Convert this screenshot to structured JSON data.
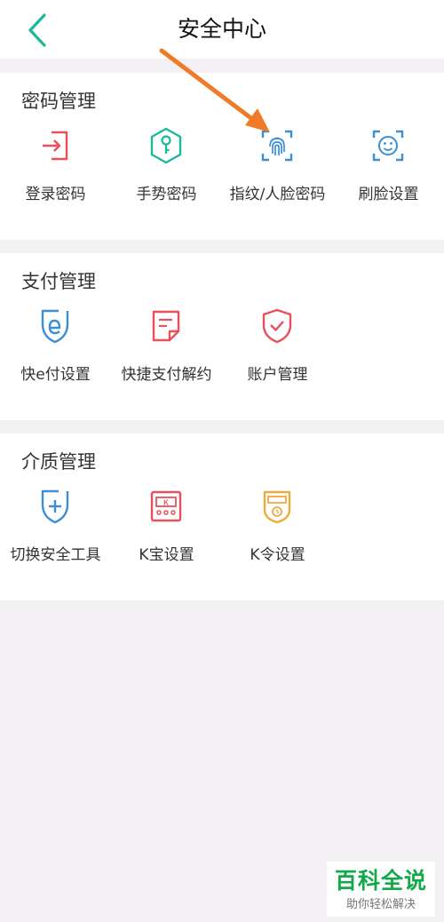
{
  "header": {
    "title": "安全中心"
  },
  "sections": [
    {
      "title": "密码管理",
      "items": [
        {
          "label": "登录密码",
          "icon": "login-icon"
        },
        {
          "label": "手势密码",
          "icon": "gesture-key-icon"
        },
        {
          "label": "指纹/人脸密码",
          "icon": "fingerprint-icon"
        },
        {
          "label": "刷脸设置",
          "icon": "face-scan-icon"
        }
      ]
    },
    {
      "title": "支付管理",
      "items": [
        {
          "label": "快e付设置",
          "icon": "e-pay-shield-icon"
        },
        {
          "label": "快捷支付解约",
          "icon": "document-icon"
        },
        {
          "label": "账户管理",
          "icon": "shield-check-icon"
        }
      ]
    },
    {
      "title": "介质管理",
      "items": [
        {
          "label": "切换安全工具",
          "icon": "shield-plus-icon"
        },
        {
          "label": "K宝设置",
          "icon": "k-token-icon"
        },
        {
          "label": "K令设置",
          "icon": "k-code-icon"
        }
      ]
    }
  ],
  "watermark": {
    "brand": "百科全说",
    "slogan": "助你轻松解决"
  },
  "colors": {
    "accent": "#1cb89e",
    "blue": "#3a8fd6",
    "red": "#e8505b",
    "orange": "#f07a28",
    "yellow": "#f2a93b",
    "watermark": "#13a84a"
  }
}
